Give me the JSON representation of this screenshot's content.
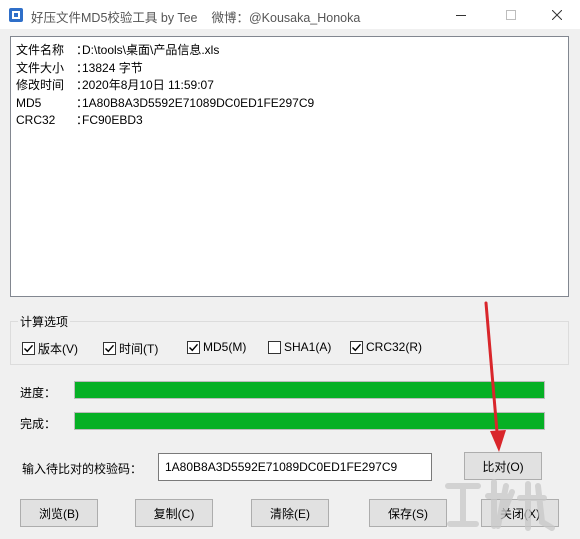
{
  "window": {
    "title": "好压文件MD5校验工具 by Tee",
    "subtitle": "微博：@Kousaka_Honoka",
    "icon": "app-icon",
    "controls": [
      "minimize-icon",
      "maximize-icon",
      "close-icon"
    ]
  },
  "output": {
    "rows": [
      {
        "key": "文件名称",
        "sep": "：",
        "value": "D:\\tools\\桌面\\产品信息.xls"
      },
      {
        "key": "文件大小",
        "sep": "：",
        "value": "13824 字节"
      },
      {
        "key": "修改时间",
        "sep": "：",
        "value": "2020年8月10日 11:59:07"
      },
      {
        "key": "MD5",
        "sep": "：",
        "value": "1A80B8A3D5592E71089DC0ED1FE297C9"
      },
      {
        "key": "CRC32",
        "sep": "：",
        "value": "FC90EBD3"
      }
    ]
  },
  "options": {
    "title": "计算选项",
    "items": [
      {
        "label": "版本(V)",
        "checked": true
      },
      {
        "label": "时间(T)",
        "checked": true
      },
      {
        "label": "MD5(M)",
        "checked": true
      },
      {
        "label": "SHA1(A)",
        "checked": false
      },
      {
        "label": "CRC32(R)",
        "checked": true
      }
    ]
  },
  "progress": {
    "progress_label": "进度：",
    "progress_value": 1.0,
    "complete_label": "完成：",
    "complete_value": 1.0,
    "fill_color": "#06b025"
  },
  "compare": {
    "label": "输入待比对的校验码：",
    "value": "1A80B8A3D5592E71089DC0ED1FE297C9",
    "button": "比对(O)"
  },
  "buttons": {
    "browse": "浏览(B)",
    "copy": "复制(C)",
    "clear": "清除(E)",
    "save": "保存(S)",
    "close": "关闭(X)"
  },
  "annotation": {
    "arrow_color": "#d9262b"
  }
}
